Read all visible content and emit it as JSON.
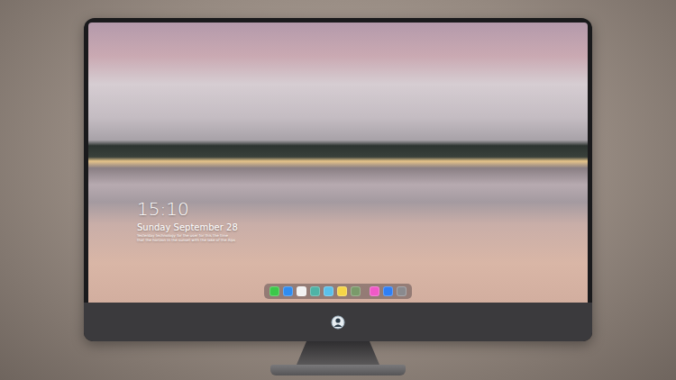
{
  "lock_screen": {
    "time": "15:10",
    "date": "Sunday September 28",
    "notes": [
      "Yesterday technology for the user for this the time",
      "that the horizon in the sunset with the lake of the Alps"
    ]
  },
  "dock": [
    {
      "items": [
        {
          "color": "#3cc84a"
        },
        {
          "color": "#2f8cf0"
        },
        {
          "color": "#f2f2f2"
        },
        {
          "color": "#4fb3a6"
        },
        {
          "color": "#5bc0ea"
        },
        {
          "color": "#f5d547"
        },
        {
          "color": "#7a9a6a"
        }
      ]
    },
    {
      "items": [
        {
          "color": "#f05ac8"
        },
        {
          "color": "#2f7ff5"
        },
        {
          "color": "#8a8a8e"
        }
      ]
    }
  ]
}
